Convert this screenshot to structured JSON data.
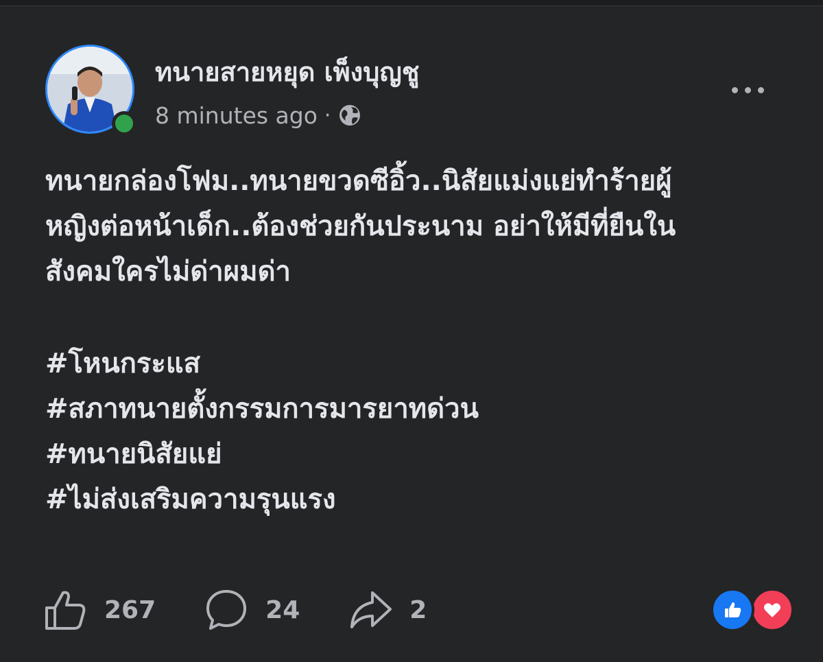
{
  "post": {
    "author": "ทนายสายหยุด เพ็งบุญชู",
    "timestamp": "8 minutes ago",
    "separator": "·",
    "audience_icon": "globe-icon",
    "body_lines": [
      "ทนายกล่องโฟม..ทนายขวดซีอิ้ว..นิสัยแม่งแย่ทำร้ายผู้",
      "หญิงต่อหน้าเด็ก..ต้องช่วยกันประนาม อย่าให้มีที่ยืนใน",
      "สังคมใครไม่ด่าผมด่า"
    ],
    "hashtags": [
      "#โหนกระแส",
      "#สภาทนายตั้งกรรมการมารยาทด่วน",
      "#ทนายนิสัยแย่",
      "#ไม่ส่งเสริมความรุนแรง"
    ]
  },
  "stats": {
    "likes": "267",
    "comments": "24",
    "shares": "2"
  },
  "reactions": [
    "like",
    "love"
  ],
  "colors": {
    "background": "#242526",
    "text_primary": "#e4e6eb",
    "text_secondary": "#b0b3b8",
    "online": "#31a24c",
    "like": "#1877f2",
    "love": "#f33e58",
    "avatar_ring": "#2d88ff"
  }
}
